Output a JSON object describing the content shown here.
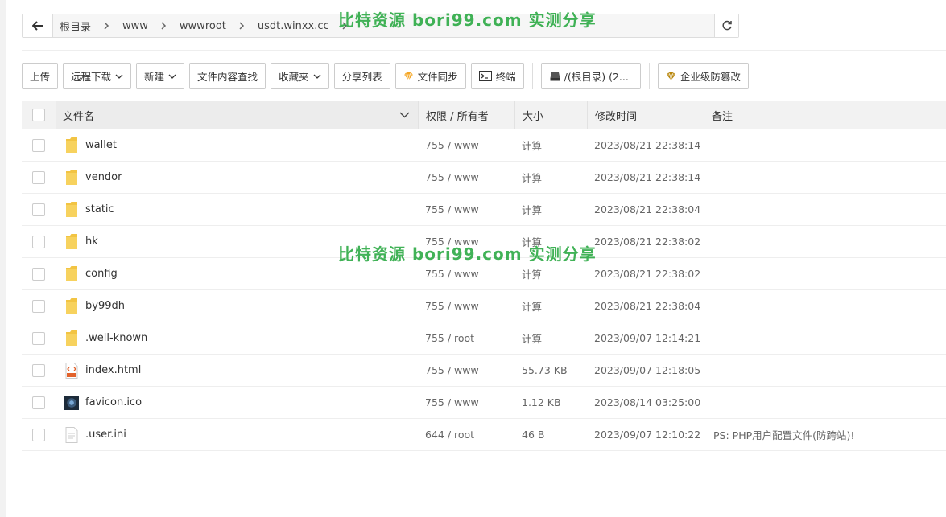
{
  "path": {
    "crumbs": [
      "根目录",
      "www",
      "wwwroot",
      "usdt.winxx.cc"
    ]
  },
  "toolbar": {
    "upload": "上传",
    "remote_download": "远程下载",
    "new": "新建",
    "search_content": "文件内容查找",
    "favorites": "收藏夹",
    "share_list": "分享列表",
    "file_sync": "文件同步",
    "terminal": "终端",
    "disk": "/(根目录) (2...",
    "tamper_protect": "企业级防篡改"
  },
  "table": {
    "headers": {
      "name": "文件名",
      "perm": "权限 / 所有者",
      "size": "大小",
      "mtime": "修改时间",
      "note": "备注"
    },
    "rows": [
      {
        "name": "wallet",
        "type": "folder",
        "perm": "755 / www",
        "size": "计算",
        "mtime": "2023/08/21 22:38:14",
        "note": ""
      },
      {
        "name": "vendor",
        "type": "folder",
        "perm": "755 / www",
        "size": "计算",
        "mtime": "2023/08/21 22:38:14",
        "note": ""
      },
      {
        "name": "static",
        "type": "folder",
        "perm": "755 / www",
        "size": "计算",
        "mtime": "2023/08/21 22:38:04",
        "note": ""
      },
      {
        "name": "hk",
        "type": "folder",
        "perm": "755 / www",
        "size": "计算",
        "mtime": "2023/08/21 22:38:02",
        "note": ""
      },
      {
        "name": "config",
        "type": "folder",
        "perm": "755 / www",
        "size": "计算",
        "mtime": "2023/08/21 22:38:02",
        "note": ""
      },
      {
        "name": "by99dh",
        "type": "folder",
        "perm": "755 / www",
        "size": "计算",
        "mtime": "2023/08/21 22:38:04",
        "note": ""
      },
      {
        "name": ".well-known",
        "type": "folder",
        "perm": "755 / root",
        "size": "计算",
        "mtime": "2023/09/07 12:14:21",
        "note": ""
      },
      {
        "name": "index.html",
        "type": "html",
        "perm": "755 / www",
        "size": "55.73 KB",
        "mtime": "2023/09/07 12:18:05",
        "note": ""
      },
      {
        "name": "favicon.ico",
        "type": "ico",
        "perm": "755 / www",
        "size": "1.12 KB",
        "mtime": "2023/08/14 03:25:00",
        "note": ""
      },
      {
        "name": ".user.ini",
        "type": "file",
        "perm": "644 / root",
        "size": "46 B",
        "mtime": "2023/09/07 12:10:22",
        "note": "PS: PHP用户配置文件(防跨站)!"
      }
    ]
  },
  "watermark": "比特资源 bori99.com 实测分享",
  "colors": {
    "accent": "#20a53a",
    "folder": "#f7c844"
  }
}
